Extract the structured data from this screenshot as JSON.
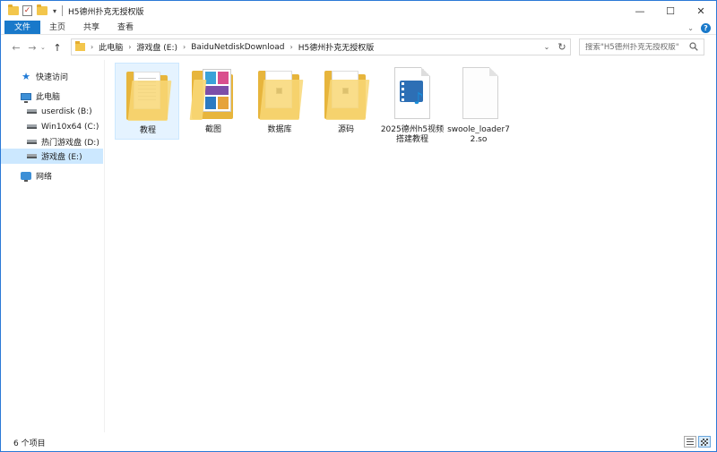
{
  "window": {
    "title": "H5德州扑克无授权版",
    "controls": {
      "minimize": "—",
      "maximize": "☐",
      "close": "✕"
    }
  },
  "ribbon": {
    "tabs": [
      "文件",
      "主页",
      "共享",
      "查看"
    ],
    "file_tab_color": "#1979ca",
    "expand_icon": "chevron-down-icon",
    "help_label": "?"
  },
  "address": {
    "breadcrumbs": [
      "此电脑",
      "游戏盘 (E:)",
      "BaiduNetdiskDownload",
      "H5德州扑克无授权版"
    ],
    "search_placeholder": "搜索\"H5德州扑克无授权版\""
  },
  "navpane": {
    "quick_access": "快速访问",
    "this_pc": "此电脑",
    "drives": [
      {
        "label": "userdisk (B:)"
      },
      {
        "label": "Win10x64 (C:)"
      },
      {
        "label": "热门游戏盘 (D:)"
      },
      {
        "label": "游戏盘 (E:)",
        "selected": true
      }
    ],
    "network": "网络",
    "selection_color": "#cce8ff"
  },
  "files": [
    {
      "name": "教程",
      "type": "folder-docs",
      "hovered": true
    },
    {
      "name": "截图",
      "type": "folder-images"
    },
    {
      "name": "数据库",
      "type": "folder"
    },
    {
      "name": "源码",
      "type": "folder"
    },
    {
      "name": "2025德州h5视频搭建教程",
      "type": "video"
    },
    {
      "name": "swoole_loader72.so",
      "type": "file"
    }
  ],
  "statusbar": {
    "item_count": "6 个项目"
  }
}
